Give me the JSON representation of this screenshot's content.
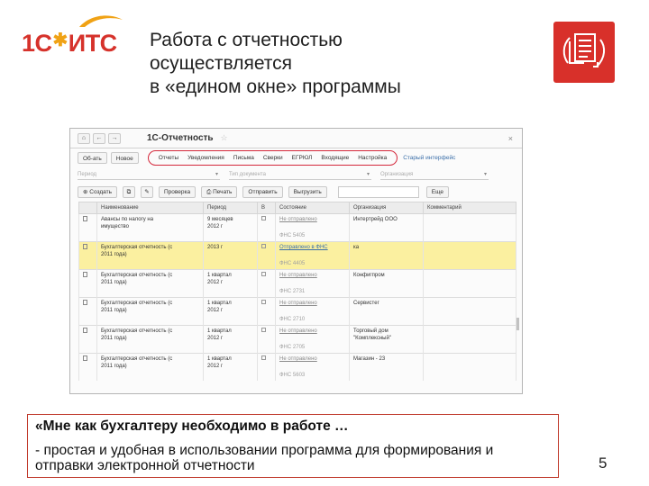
{
  "slide": {
    "logo_text_a": "1С",
    "logo_text_b": "ИТС",
    "title_lines": [
      "Работа с отчетностью",
      "осуществляется",
      "в «едином окне» программы"
    ],
    "page_number": "5",
    "icon": "document-exchange-icon",
    "accent_color": "#d8302a"
  },
  "app": {
    "title": "1С-Отчетность",
    "nav": {
      "home_icon": "home-icon",
      "back_icon": "back-arrow-icon",
      "forward_icon": "forward-arrow-icon"
    },
    "buttons": {
      "create_label": "Об-ать",
      "new_label": "Новое"
    },
    "tabs": [
      "Отчеты",
      "Уведомления",
      "Письма",
      "Сверки",
      "ЕГРЮЛ",
      "Входящие",
      "Настройка"
    ],
    "old_interface_link": "Старый интерфейс",
    "filters": [
      "Период",
      "Тип документа",
      "Организация"
    ],
    "toolbar": {
      "create": "Создать",
      "check": "Проверка",
      "print": "Печать",
      "send": "Отправить",
      "export": "Выгрузить",
      "more": "Еще"
    },
    "columns": [
      "Наименование",
      "Период",
      "В",
      "Состояние",
      "Организация",
      "Комментарий"
    ],
    "rows": [
      {
        "name1": "Авансы по налогу на",
        "name2": "имущество",
        "period1": "9 месяцев",
        "period2": "2012 г",
        "state": "Не отправлено",
        "org": "Интертрейд ООО",
        "sub": "ФНС 5405",
        "highlight": false
      },
      {
        "name1": "Бухгалтерская отчетность (с",
        "name2": "2011 года)",
        "period1": "2013 г",
        "period2": "",
        "state": "Отправлено в ФНС",
        "org": "ка",
        "sub": "ФНС 4405",
        "highlight": true
      },
      {
        "name1": "Бухгалтерская отчетность (с",
        "name2": "2011 года)",
        "period1": "1 квартал",
        "period2": "2012 г",
        "state": "Не отправлено",
        "org": "Конфигпром",
        "sub": "ФНС 2731",
        "highlight": false
      },
      {
        "name1": "Бухгалтерская отчетность (с",
        "name2": "2011 года)",
        "period1": "1 квартал",
        "period2": "2012 г",
        "state": "Не отправлено",
        "org": "Сервистег",
        "sub": "ФНС 2710",
        "highlight": false
      },
      {
        "name1": "Бухгалтерская отчетность (с",
        "name2": "2011 года)",
        "period1": "1 квартал",
        "period2": "2012 г",
        "state": "Не отправлено",
        "org": "Торговый дом",
        "org2": "\"Комплексный\"",
        "sub": "ФНС 2705",
        "highlight": false
      },
      {
        "name1": "Бухгалтерская отчетность (с",
        "name2": "2011 года)",
        "period1": "1 квартал",
        "period2": "2012 г",
        "state": "Не отправлено",
        "org": "Магазин - 23",
        "sub": "ФНС 5603",
        "highlight": false
      }
    ]
  },
  "quote": {
    "line1": "«Мне как бухгалтеру необходимо в работе …",
    "line2": "- простая и удобная в использовании программа для формирования и отправки электронной отчетности"
  }
}
